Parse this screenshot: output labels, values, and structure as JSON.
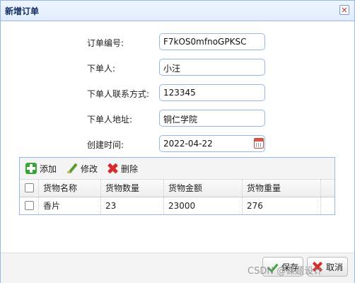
{
  "window": {
    "title": "新增订单",
    "close_symbol": "✕"
  },
  "form": {
    "fields": [
      {
        "label": "订单编号:",
        "value": "F7kOS0mfnoGPKSC"
      },
      {
        "label": "下单人:",
        "value": "小汪"
      },
      {
        "label": "下单人联系方式:",
        "value": "123345"
      },
      {
        "label": "下单人地址:",
        "value": "铜仁学院"
      },
      {
        "label": "创建时间:",
        "value": "2022-04-22"
      }
    ],
    "date_picker_icon": "calendar-icon"
  },
  "toolbar": {
    "add_label": "添加",
    "edit_label": "修改",
    "remove_label": "删除"
  },
  "grid": {
    "columns": [
      "货物名称",
      "货物数量",
      "货物金额",
      "货物重量"
    ],
    "rows": [
      {
        "name": "香片",
        "quantity": "23",
        "amount": "23000",
        "weight": "276"
      }
    ]
  },
  "footer": {
    "save_label": "保存",
    "cancel_label": "取消"
  },
  "watermark": "CSDN @课题设计",
  "colors": {
    "accent_border": "#95b8e7",
    "title_gradient_top": "#eff5ff",
    "title_gradient_bottom": "#e0ecff"
  }
}
